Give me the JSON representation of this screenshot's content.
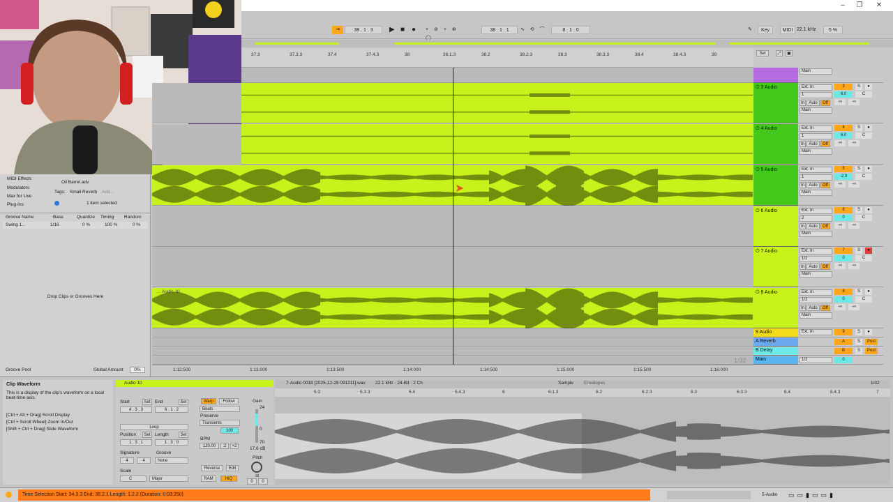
{
  "window": {
    "minimize": "–",
    "maximize": "❐",
    "close": "✕"
  },
  "control_bar": {
    "arrangement_pos": "38 . 1 . 3",
    "loop_start": "38 . 1 . 1",
    "loop_length": "8 . 1 . 0",
    "key_label": "Key",
    "midi_label": "MIDI",
    "sample_rate": "22.1 kHz",
    "cpu": "5 %"
  },
  "ruler": {
    "ticks": [
      "37.3",
      "37.3.3",
      "37.4",
      "37.4.3",
      "38",
      "38.1.3",
      "38.2",
      "38.2.3",
      "38.3",
      "38.3.3",
      "38.4",
      "38.4.3",
      "39"
    ],
    "set_label": "Set"
  },
  "timeline_bottom": {
    "ticks": [
      "1:12:500",
      "1:13:000",
      "1:13:500",
      "1:14:000",
      "1:14:500",
      "1:15:000",
      "1:15:500",
      "1:16:000"
    ],
    "zoom": "1/32"
  },
  "tracks": [
    {
      "name": "3 Audio",
      "input": "Ext. In",
      "channel": "1",
      "monitor": [
        "In",
        "Auto",
        "Off"
      ],
      "output": "Main",
      "number": "3",
      "vol": "6.0",
      "pan": "C",
      "send": "-∞",
      "color": "#44c91a"
    },
    {
      "name": "4 Audio",
      "input": "Ext. In",
      "channel": "1",
      "monitor": [
        "In",
        "Auto",
        "Off"
      ],
      "output": "Main",
      "number": "4",
      "vol": "6.0",
      "pan": "C",
      "send": "-∞",
      "color": "#44c91a"
    },
    {
      "name": "5 Audio",
      "input": "Ext. In",
      "channel": "1",
      "monitor": [
        "In",
        "Auto",
        "Off"
      ],
      "output": "Main",
      "number": "5",
      "vol": "-2.0",
      "pan": "C",
      "send": "-∞",
      "color": "#44c91a"
    },
    {
      "name": "6 Audio",
      "input": "Ext. In",
      "channel": "2",
      "monitor": [
        "In",
        "Auto",
        "Off"
      ],
      "output": "Main",
      "number": "6",
      "vol": "0",
      "pan": "C",
      "send": "-∞",
      "color": "#c7f21b"
    },
    {
      "name": "7 Audio",
      "input": "Ext. In",
      "channel": "1/2",
      "monitor": [
        "In",
        "Auto",
        "Off"
      ],
      "output": "Main",
      "number": "7",
      "vol": "0",
      "pan": "C",
      "send": "-∞",
      "color": "#c7f21b"
    },
    {
      "name": "8 Audio",
      "input": "Ext. In",
      "channel": "1/2",
      "monitor": [
        "In",
        "Auto",
        "Off"
      ],
      "output": "Main",
      "number": "8",
      "vol": "0",
      "pan": "C",
      "send": "-∞",
      "color": "#c7f21b"
    }
  ],
  "track9": {
    "name": "9 Audio",
    "input": "Ext. In",
    "number": "9"
  },
  "returns": [
    {
      "name": "A Reverb",
      "number": "A",
      "mode": "Post"
    },
    {
      "name": "B Delay",
      "number": "B",
      "mode": "Post"
    }
  ],
  "main_track": {
    "name": "Main",
    "output": "1/2",
    "vol": "0"
  },
  "top_output": "Main",
  "clip_label": "Audio 10",
  "browser": {
    "categories": [
      "MIDI Effects",
      "Modulators",
      "Max for Live",
      "Plug-Ins"
    ],
    "selected_file": "Oil Barrel.adv",
    "tags_label": "Tags:",
    "tag_value": "Small Reverb",
    "add_tag": "Add...",
    "selection_info": "1 item selected",
    "groove_cols": [
      "Groove Name",
      "Base",
      "Quantize",
      "Timing",
      "Random"
    ],
    "groove_row": {
      "name": "Swing 1...",
      "base": "1/16",
      "quantize": "0 %",
      "timing": "100 %",
      "random": "0 %"
    },
    "drop_hint": "Drop Clips or Grooves Here",
    "groove_pool": "Groove Pool",
    "global_amount_label": "Global Amount",
    "global_amount": "0%"
  },
  "info": {
    "title": "Clip Waveform",
    "body": "This is a display of the clip's waveform on a local beat-time axis.",
    "hints": [
      "[Ctrl + Alt + Drag] Scroll Display",
      "[Ctrl + Scroll Wheel] Zoom In/Out",
      "[Shift + Ctrl + Drag] Slide Waveform"
    ]
  },
  "clip": {
    "name": "Audio 10",
    "start_label": "Start",
    "end_label": "End",
    "set_label": "Set",
    "start": "4 . 3 . 3",
    "end": "6 . 1 . 2",
    "loop_label": "Loop",
    "position_label": "Position",
    "length_label": "Length",
    "position": "1 . 3 . 1",
    "length": "1 . 3 . 0",
    "signature_label": "Signature",
    "sig_num": "4",
    "sig_den": "4",
    "groove_label": "Groove",
    "groove_value": "None",
    "scale_label": "Scale",
    "scale_root": "C",
    "scale_mode": "Major",
    "warp": "Warp",
    "follow": "Follow",
    "warp_mode": "Beats",
    "preserve_label": "Preserve",
    "preserve": "Transients",
    "loop_pct": "100",
    "bpm_label": "BPM",
    "bpm": "120.00",
    "half": ":2",
    "double": "×2",
    "reverse": "Reverse",
    "edit": "Edit",
    "ram": "RAM",
    "hiq": "HiQ",
    "gain_label": "Gain",
    "gain_top": "24",
    "gain_mid": "0",
    "gain_low": "70",
    "gain_db": "17.6 dB",
    "pitch_label": "Pitch",
    "pitch_st": "st",
    "pitch": "0",
    "detune": "0"
  },
  "sample": {
    "file": "7-Audio 0018 [2025-12-28 091211].wav",
    "info": "22.1 kHz · 24-Bit · 2 Ch",
    "tab_sample": "Sample",
    "tab_envelopes": "Envelopes",
    "zoom": "1/32",
    "ticks": [
      "5.3",
      "5.3.3",
      "5.4",
      "5.4.3",
      "6",
      "6.1.3",
      "6.2",
      "6.2.3",
      "6.3",
      "6.3.3",
      "6.4",
      "6.4.3",
      "7"
    ]
  },
  "status": {
    "text": "Time Selection   Start: 34.3.3   End: 36.2.1   Length: 1.2.2  (Duration: 0:03:250)",
    "track": "5-Audio"
  },
  "colors": {
    "clip": "#c7f21b",
    "accent": "#ffa61a",
    "header_green": "#44c91a",
    "purple": "#b46ae0",
    "status_orange": "#ff7a1a"
  }
}
